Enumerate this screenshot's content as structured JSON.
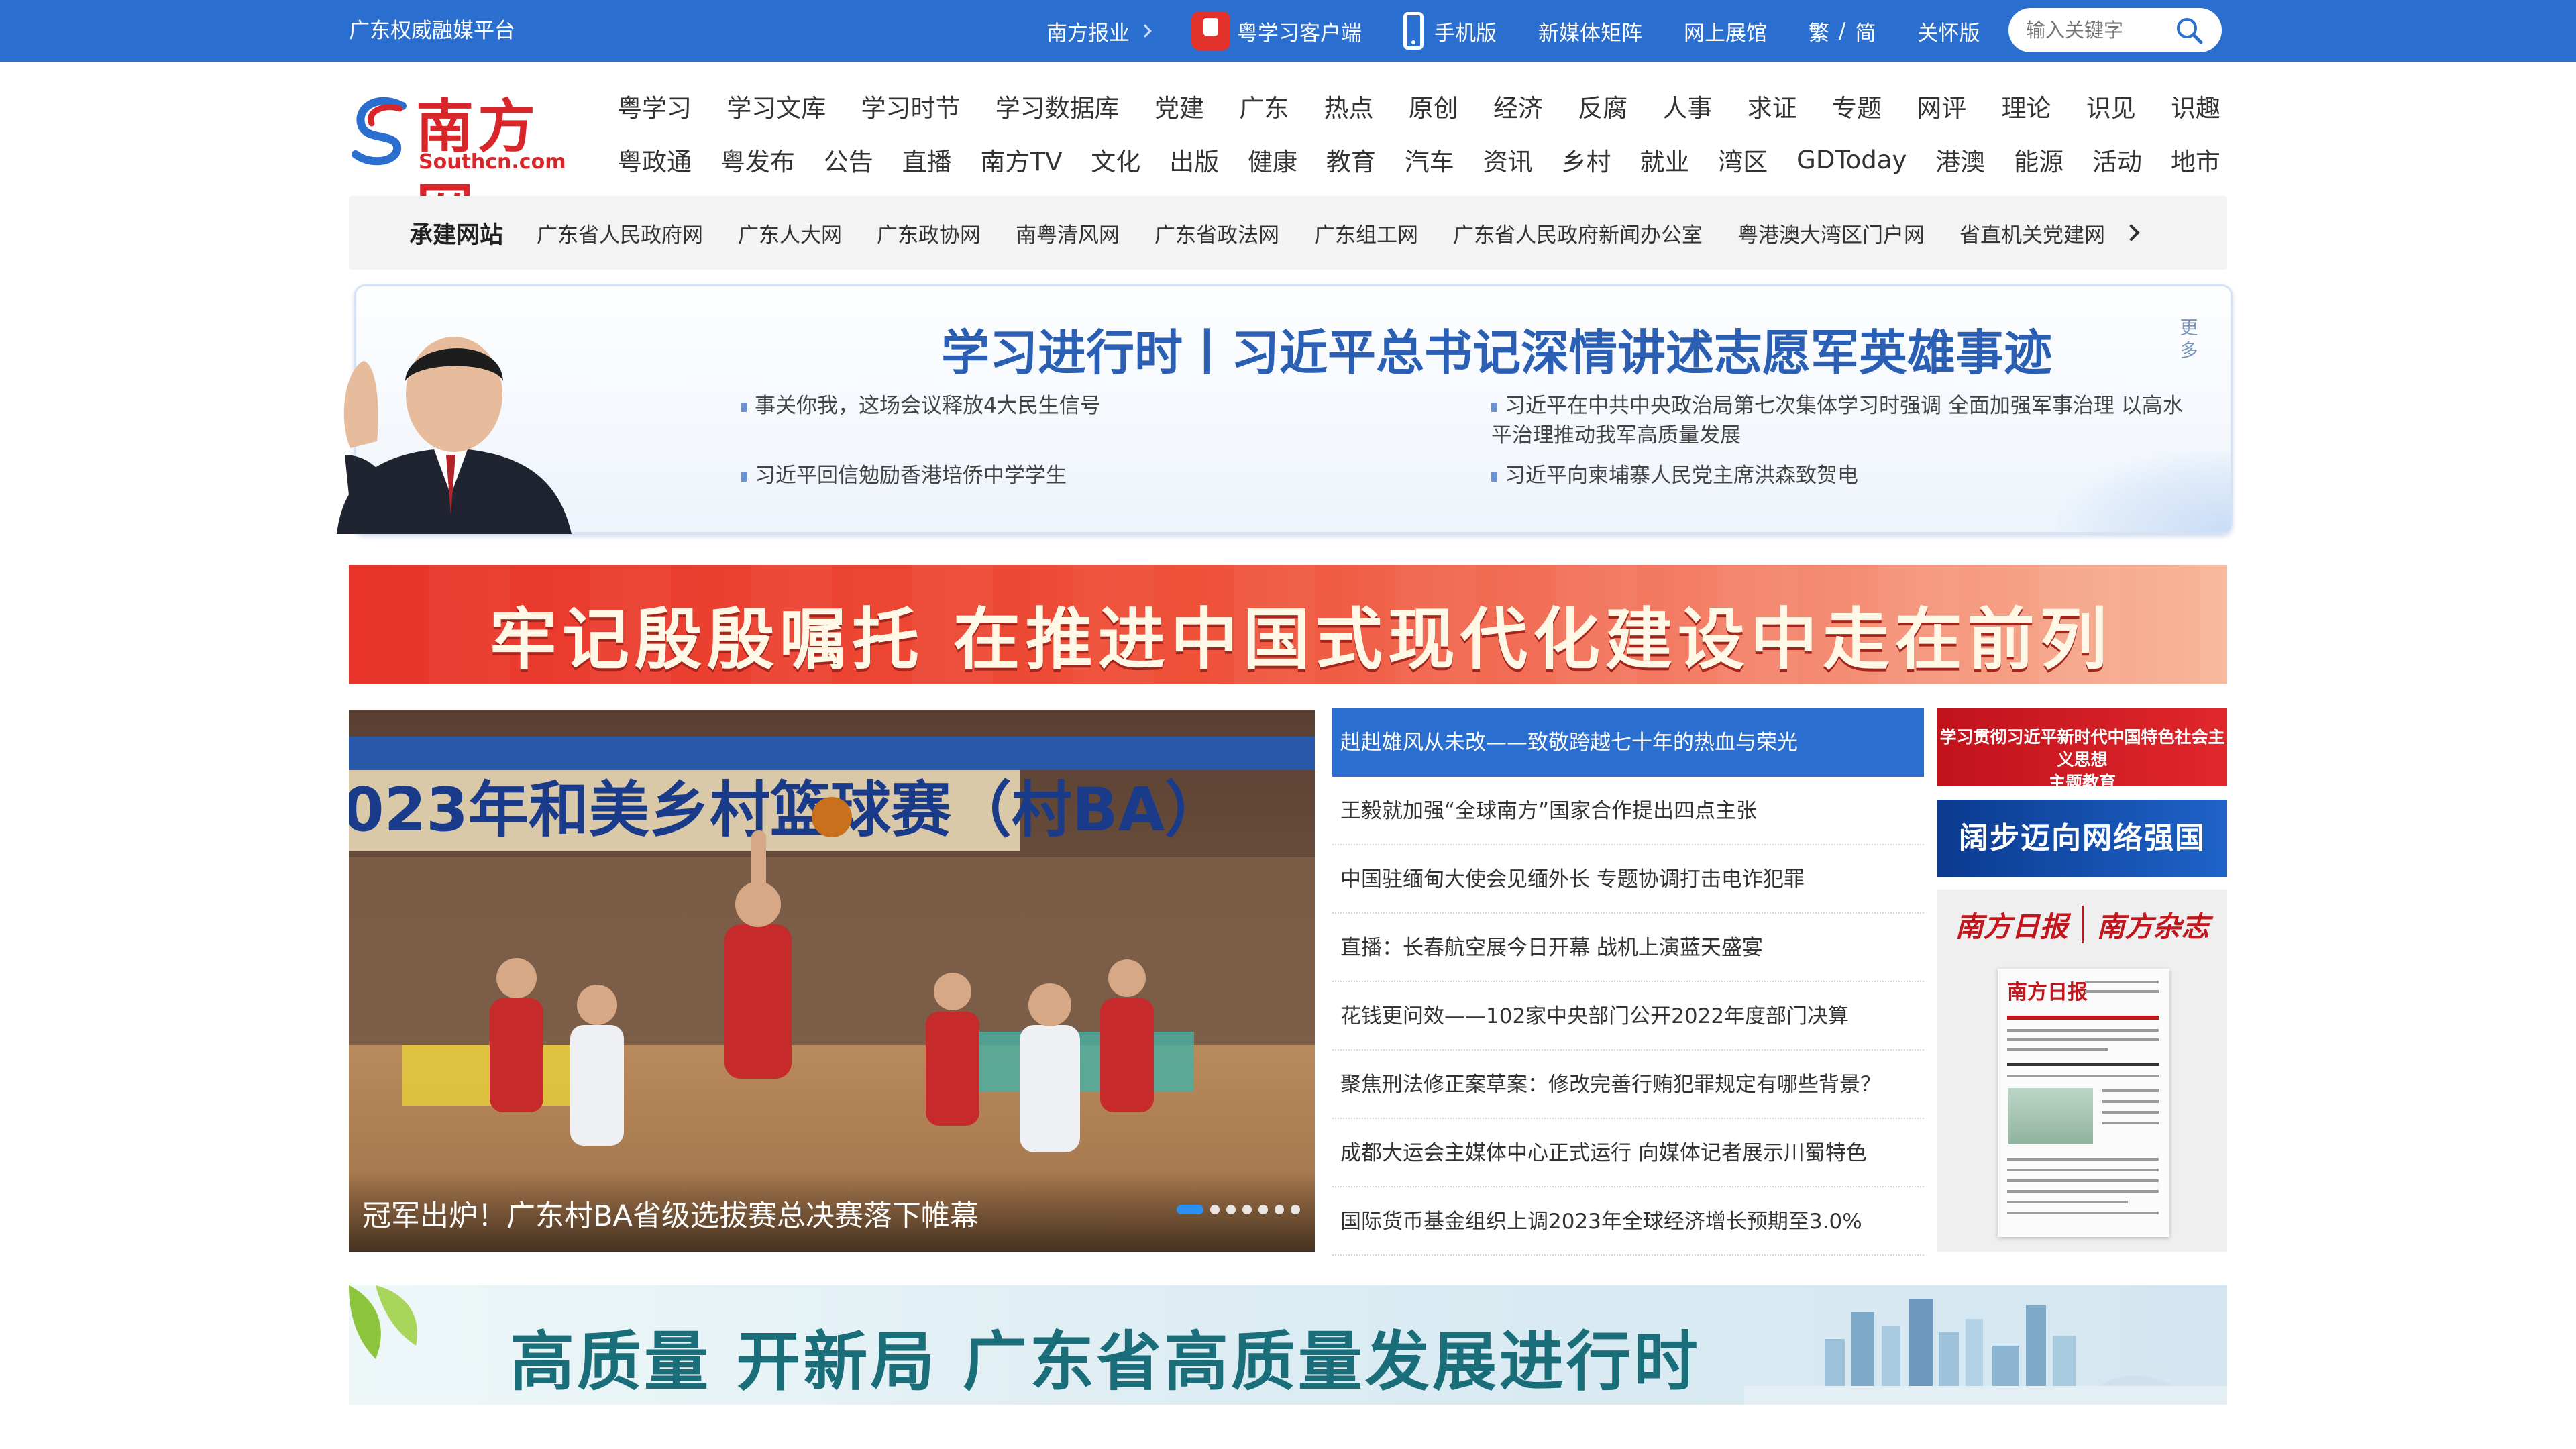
{
  "topbar": {
    "brand": "广东权威融媒平台",
    "nav": [
      "南方报业",
      "粤学习客户端",
      "手机版",
      "新媒体矩阵",
      "网上展馆"
    ],
    "lang_trad": "繁",
    "lang_sep": "/",
    "lang_simp": "简",
    "care": "关怀版",
    "search_placeholder": "输入关键字"
  },
  "logo": {
    "text": "南方网",
    "sub": "Southcn.com"
  },
  "mainnav": {
    "row1": [
      "粤学习",
      "学习文库",
      "学习时节",
      "学习数据库",
      "党建",
      "广东",
      "热点",
      "原创",
      "经济",
      "反腐",
      "人事",
      "求证",
      "专题",
      "网评",
      "理论",
      "识见",
      "识趣"
    ],
    "row2": [
      "粤政通",
      "粤发布",
      "公告",
      "直播",
      "南方TV",
      "文化",
      "出版",
      "健康",
      "教育",
      "汽车",
      "资讯",
      "乡村",
      "就业",
      "湾区",
      "GDToday",
      "港澳",
      "能源",
      "活动",
      "地市"
    ]
  },
  "partners": {
    "label": "承建网站",
    "sites": [
      "广东省人民政府网",
      "广东人大网",
      "广东政协网",
      "南粤清风网",
      "广东省政法网",
      "广东组工网",
      "广东省人民政府新闻办公室",
      "粤港澳大湾区门户网",
      "省直机关党建网"
    ]
  },
  "study": {
    "title": "学习进行时丨习近平总书记深情讲述志愿军英雄事迹",
    "more": "更多",
    "items": [
      "事关你我，这场会议释放4大民生信号",
      "习近平在中共中央政治局第七次集体学习时强调 全面加强军事治理 以高水平治理推动我军高质量发展",
      "习近平回信勉励香港培侨中学学生",
      "习近平向柬埔寨人民党主席洪森致贺电"
    ]
  },
  "red_banner": {
    "text": "牢记殷殷嘱托 在推进中国式现代化建设中走在前列"
  },
  "carousel": {
    "caption": "冠军出炉！广东村BA省级选拔赛总决赛落下帷幕",
    "slide_count": 7,
    "active_index": 0,
    "photo_signage": "023年和美乡村篮球赛（村BA）"
  },
  "headlines": [
    "赳赳雄风从未改——致敬跨越七十年的热血与荣光",
    "王毅就加强“全球南方”国家合作提出四点主张",
    "中国驻缅甸大使会见缅外长 专题协调打击电诈犯罪",
    "直播：长春航空展今日开幕 战机上演蓝天盛宴",
    "花钱更问效——102家中央部门公开2022年度部门决算",
    "聚焦刑法修正案草案：修改完善行贿犯罪规定有哪些背景？",
    "成都大运会主媒体中心正式运行 向媒体记者展示川蜀特色",
    "国际货币基金组织上调2023年全球经济增长预期至3.0%"
  ],
  "right_column": {
    "promo1_line1": "学习贯彻习近平新时代中国特色社会主义思想",
    "promo1_line2": "主题教育",
    "promo2": "阔步迈向网络强国",
    "mast_left": "南方日报",
    "mast_right": "南方杂志",
    "paper_title": "南方日报"
  },
  "bottom_banner": {
    "text": "高质量 开新局 广东省高质量发展进行时"
  },
  "colors": {
    "top_bar": "#2a6fd0",
    "brand_red": "#d8262a",
    "study_title": "#2b5fb3",
    "headline_active": "#2a6fd0"
  }
}
